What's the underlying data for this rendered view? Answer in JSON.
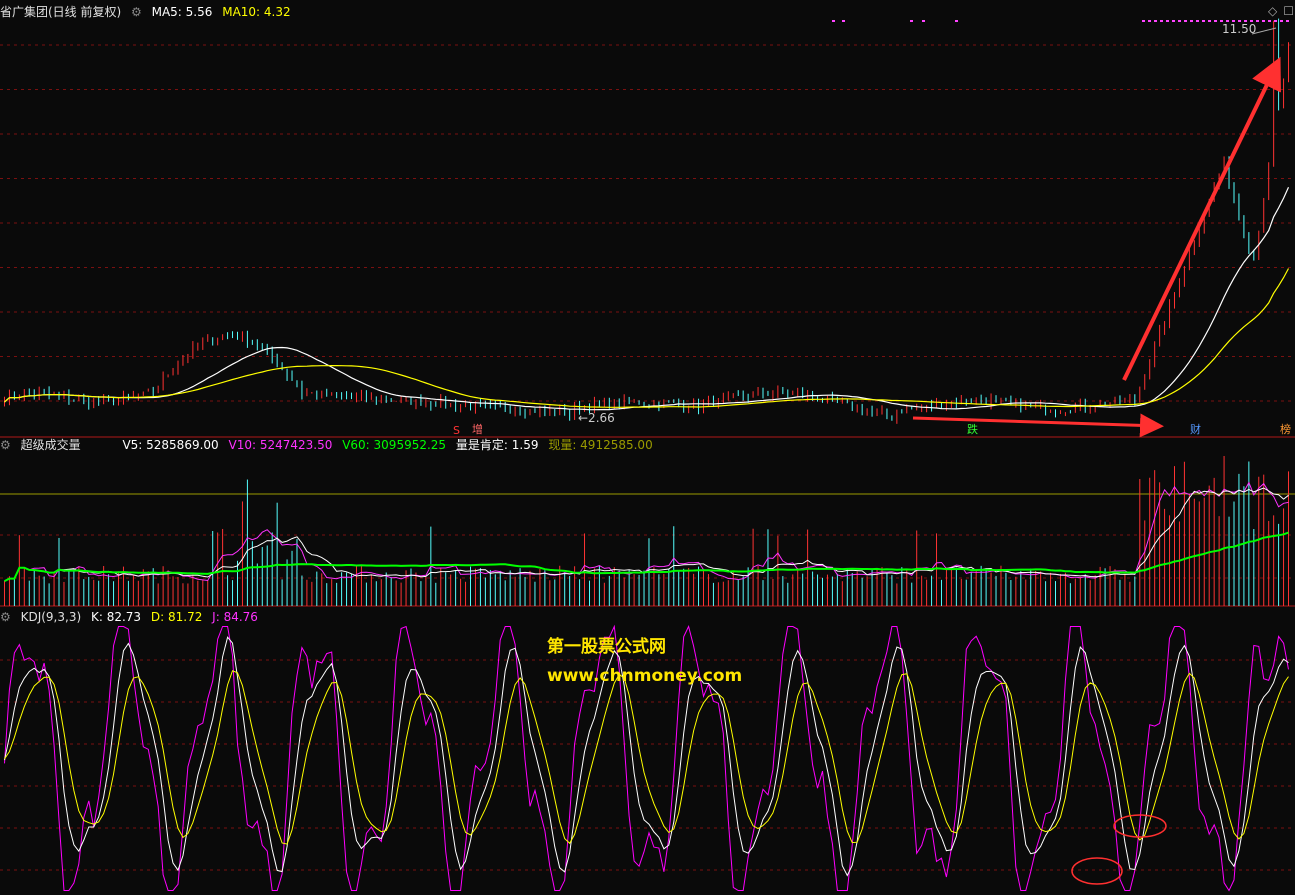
{
  "price_header": {
    "title": "省广集团(日线 前复权)",
    "ma5_label": "MA5: 5.56",
    "ma10_label": "MA10: 4.32"
  },
  "volume_header": {
    "title": "超级成交量",
    "v5": "V5: 5285869.00",
    "v10": "V10: 5247423.50",
    "v60": "V60: 3095952.25",
    "ratio": "量是肯定: 1.59",
    "current": "现量: 4912585.00"
  },
  "kdj_header": {
    "title": "KDJ(9,3,3)",
    "k": "K: 82.73",
    "d": "D: 81.72",
    "j": "J: 84.76"
  },
  "annotations": {
    "low_label": "←2.66",
    "high_label": "11.50",
    "tag_s": "S",
    "tag_zeng": "增",
    "tag_die": "跌",
    "tag_cai": "财",
    "tag_bang": "榜"
  },
  "watermark": {
    "line1": "第一股票公式网",
    "line2": "www.chnmoney.com"
  },
  "colors": {
    "background": "#0a0a0a",
    "grid": "#7a1010",
    "up_candle": "#ff3232",
    "down_candle": "#54ffff",
    "ma5": "#ffffff",
    "ma10": "#ffff00",
    "v60": "#00ff00",
    "kdj_k": "#ffffff",
    "kdj_d": "#ffff00",
    "kdj_j": "#ff00ff",
    "arrow": "#ff3030"
  },
  "chart_data": [
    {
      "type": "candlestick",
      "panel": "price",
      "title": "省广集团(日线 前复权)",
      "ylim": [
        2.3,
        11.8
      ],
      "low_point": 2.66,
      "high_point": 11.5,
      "series": [
        {
          "name": "MA5",
          "value": 5.56
        },
        {
          "name": "MA10",
          "value": 4.32
        }
      ]
    },
    {
      "type": "bar",
      "panel": "volume",
      "title": "超级成交量",
      "series": [
        {
          "name": "V5",
          "value": 5285869.0
        },
        {
          "name": "V10",
          "value": 5247423.5
        },
        {
          "name": "V60",
          "value": 3095952.25
        },
        {
          "name": "量是肯定",
          "value": 1.59
        },
        {
          "name": "现量",
          "value": 4912585.0
        }
      ]
    },
    {
      "type": "line",
      "panel": "indicator",
      "title": "KDJ(9,3,3)",
      "ylim": [
        -10,
        110
      ],
      "series": [
        {
          "name": "K",
          "value": 82.73
        },
        {
          "name": "D",
          "value": 81.72
        },
        {
          "name": "J",
          "value": 84.76
        }
      ]
    }
  ]
}
